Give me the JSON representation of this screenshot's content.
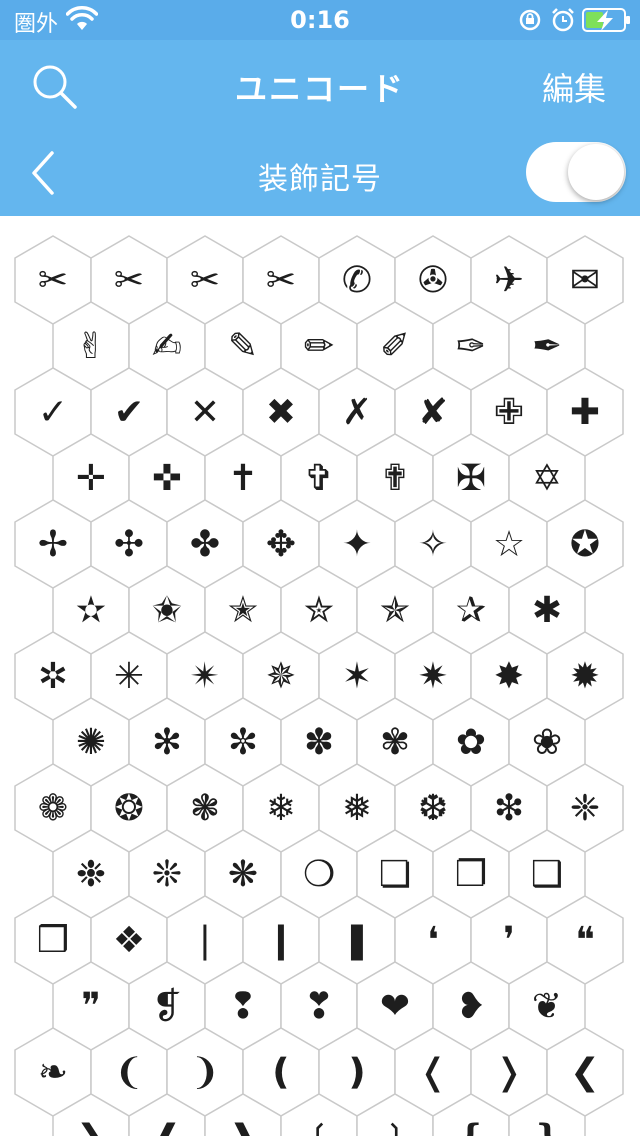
{
  "status": {
    "carrier": "圏外",
    "time": "0:16"
  },
  "nav": {
    "title": "ユニコード",
    "edit": "編集",
    "subtitle": "装飾記号"
  },
  "toggle": {
    "on": true
  },
  "symbol_rows": [
    [
      "✂",
      "✂",
      "✂",
      "✂",
      "✆",
      "✇",
      "✈",
      "✉"
    ],
    [
      "✌",
      "✍",
      "✎",
      "✏",
      "✐",
      "✑",
      "✒"
    ],
    [
      "✓",
      "✔",
      "✕",
      "✖",
      "✗",
      "✘",
      "✙",
      "✚"
    ],
    [
      "✛",
      "✜",
      "✝",
      "✞",
      "✟",
      "✠",
      "✡"
    ],
    [
      "✢",
      "✣",
      "✤",
      "✥",
      "✦",
      "✧",
      "☆",
      "✪"
    ],
    [
      "✫",
      "✬",
      "✭",
      "✮",
      "✯",
      "✰",
      "✱"
    ],
    [
      "✲",
      "✳",
      "✴",
      "✵",
      "✶",
      "✷",
      "✸",
      "✹"
    ],
    [
      "✺",
      "✻",
      "✼",
      "✽",
      "✾",
      "✿",
      "❀"
    ],
    [
      "❁",
      "❂",
      "❃",
      "❄",
      "❅",
      "❆",
      "❇",
      "❈"
    ],
    [
      "❉",
      "❊",
      "❋",
      "❍",
      "❏",
      "❐",
      "❑"
    ],
    [
      "❒",
      "❖",
      "❘",
      "❙",
      "❚",
      "❛",
      "❜",
      "❝"
    ],
    [
      "❞",
      "❡",
      "❢",
      "❣",
      "❤",
      "❥",
      "❦"
    ],
    [
      "❧",
      "❨",
      "❩",
      "❪",
      "❫",
      "❬",
      "❭",
      "❮"
    ],
    [
      "❯",
      "❰",
      "❱",
      "❲",
      "❳",
      "❴",
      "❵"
    ]
  ]
}
